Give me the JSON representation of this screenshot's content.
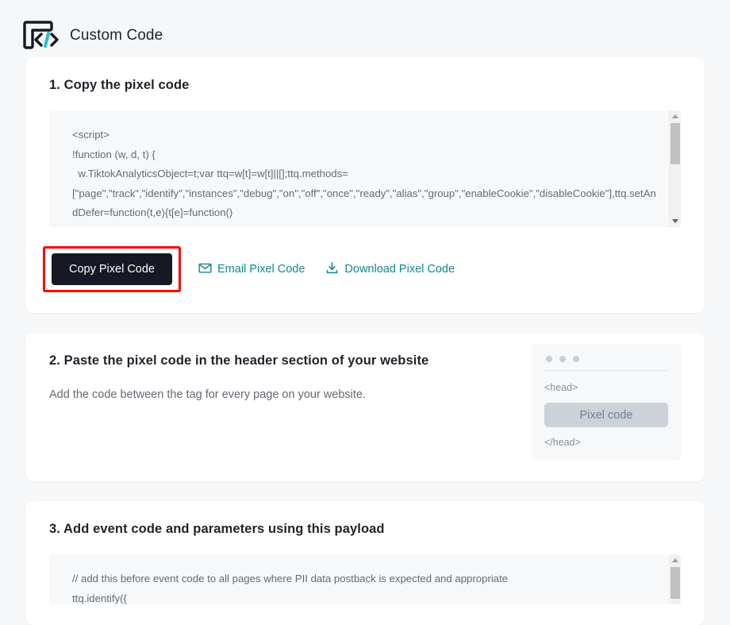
{
  "header": {
    "title": "Custom Code",
    "icon": "custom-code-icon"
  },
  "steps": [
    {
      "id": "step-1",
      "title": "1. Copy the pixel code",
      "code": "<script>\n!function (w, d, t) {\n  w.TiktokAnalyticsObject=t;var ttq=w[t]=w[t]||[];ttq.methods=\n[\"page\",\"track\",\"identify\",\"instances\",\"debug\",\"on\",\"off\",\"once\",\"ready\",\"alias\",\"group\",\"enableCookie\",\"disableCookie\"],ttq.setAndDefer=function(t,e){t[e]=function()",
      "actions": {
        "copy_label": "Copy Pixel Code",
        "email_label": "Email Pixel Code",
        "download_label": "Download Pixel Code",
        "email_icon": "envelope-icon",
        "download_icon": "download-icon"
      }
    },
    {
      "id": "step-2",
      "title": "2. Paste the pixel code in the header section of your website",
      "description": "Add the code between the tag for every page on your website.",
      "illustration": {
        "open_tag": "<head>",
        "pill_label": "Pixel code",
        "close_tag": "</head>"
      }
    },
    {
      "id": "step-3",
      "title": "3. Add event code and parameters using this payload",
      "code": "// add this before event code to all pages where PII data postback is expected and appropriate\nttq.identify({"
    }
  ],
  "colors": {
    "accent_teal": "#12888b",
    "button_dark": "#161823",
    "highlight_red": "#ff0000",
    "page_bg": "#f5f7f9",
    "code_bg": "#f7f8fa"
  }
}
